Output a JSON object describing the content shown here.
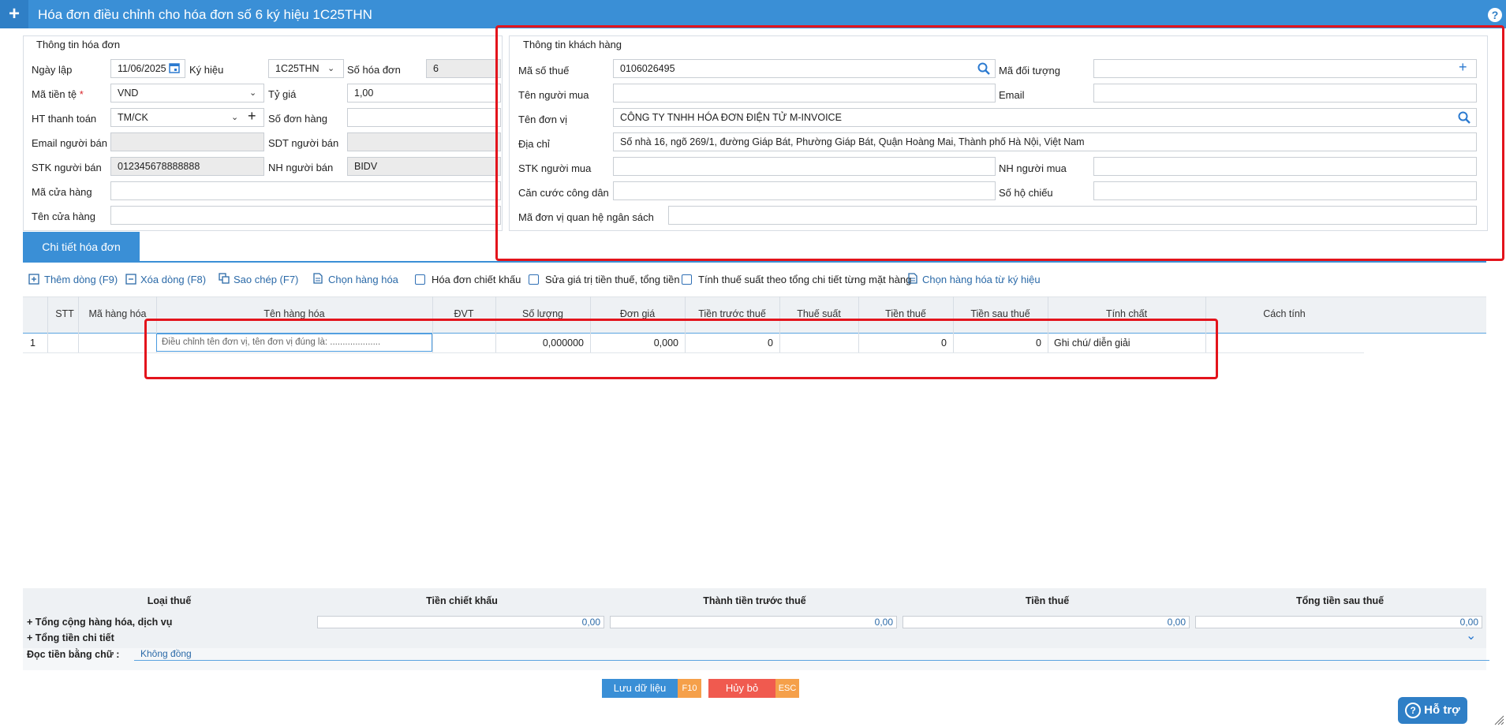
{
  "window": {
    "title": "Hóa đơn điều chỉnh cho hóa đơn số 6 ký hiệu 1C25THN",
    "help_glyph": "?"
  },
  "invoice_info": {
    "section_title": "Thông tin hóa đơn",
    "ngay_lap_label": "Ngày lập",
    "ngay_lap_value": "11/06/2025",
    "ky_hieu_label": "Ký hiệu",
    "ky_hieu_value": "1C25THN",
    "so_hoa_don_label": "Số hóa đơn",
    "so_hoa_don_value": "6",
    "ma_tien_te_label": "Mã tiền tệ",
    "required_mark": "*",
    "ma_tien_te_value": "VND",
    "ty_gia_label": "Tỷ giá",
    "ty_gia_value": "1,00",
    "ht_thanh_toan_label": "HT thanh toán",
    "ht_thanh_toan_value": "TM/CK",
    "so_don_hang_label": "Số đơn hàng",
    "so_don_hang_value": "",
    "email_nguoi_ban_label": "Email người bán",
    "email_nguoi_ban_value": "",
    "sdt_nguoi_ban_label": "SDT người bán",
    "sdt_nguoi_ban_value": "",
    "stk_nguoi_ban_label": "STK người bán",
    "stk_nguoi_ban_value": "012345678888888",
    "nh_nguoi_ban_label": "NH người bán",
    "nh_nguoi_ban_value": "BIDV",
    "ma_cua_hang_label": "Mã cửa hàng",
    "ma_cua_hang_value": "",
    "ten_cua_hang_label": "Tên cửa hàng",
    "ten_cua_hang_value": ""
  },
  "customer_info": {
    "section_title": "Thông tin khách hàng",
    "ma_so_thue_label": "Mã số thuế",
    "ma_so_thue_value": "0106026495",
    "ma_doi_tuong_label": "Mã đối tượng",
    "ma_doi_tuong_value": "",
    "ten_nguoi_mua_label": "Tên người mua",
    "ten_nguoi_mua_value": "",
    "email_label": "Email",
    "email_value": "",
    "ten_don_vi_label": "Tên đơn vị",
    "ten_don_vi_value": "CÔNG TY TNHH HÓA ĐƠN ĐIỆN TỬ M-INVOICE",
    "dia_chi_label": "Địa chỉ",
    "dia_chi_value": "Số nhà 16, ngõ 269/1, đường Giáp Bát, Phường Giáp Bát, Quận Hoàng Mai, Thành phố Hà Nội, Việt Nam",
    "stk_nguoi_mua_label": "STK người mua",
    "stk_nguoi_mua_value": "",
    "nh_nguoi_mua_label": "NH người mua",
    "nh_nguoi_mua_value": "",
    "cccd_label": "Căn cước công dân",
    "cccd_value": "",
    "so_ho_chieu_label": "Số hộ chiếu",
    "so_ho_chieu_value": "",
    "ma_dvqhns_label": "Mã đơn vị quan hệ ngân sách",
    "ma_dvqhns_value": ""
  },
  "details": {
    "tab_label": "Chi tiết hóa đơn",
    "toolbar": {
      "add_row": "Thêm dòng (F9)",
      "delete_row": "Xóa dòng (F8)",
      "copy": "Sao chép (F7)",
      "choose_goods": "Chọn hàng hóa",
      "discount_invoice": "Hóa đơn chiết khấu",
      "edit_tax_total": "Sửa giá trị tiền thuế, tổng tiền",
      "calc_tax_rate": "Tính thuế suất theo tổng chi tiết từng mặt hàng",
      "choose_goods_from_symbol": "Chọn hàng hóa từ ký hiệu"
    },
    "columns": [
      "STT",
      "Mã hàng hóa",
      "Tên hàng hóa",
      "ĐVT",
      "Số lượng",
      "Đơn giá",
      "Tiền trước thuế",
      "Thuế suất",
      "Tiền thuế",
      "Tiền sau thuế",
      "Tính chất",
      "Cách tính"
    ],
    "rows": [
      {
        "index": "1",
        "stt": "",
        "ma_hang_hoa": "",
        "ten_hang_hoa": "Điều chỉnh tên đơn vị, tên đơn vị đúng là: ....................",
        "dvt": "",
        "so_luong": "0,000000",
        "don_gia": "0,000",
        "tien_truoc_thue": "0",
        "thue_suat": "",
        "tien_thue": "0",
        "tien_sau_thue": "0",
        "tinh_chat": "Ghi chú/ diễn giải",
        "cach_tinh": ""
      }
    ]
  },
  "summary": {
    "headers": [
      "Loại thuế",
      "Tiền chiết khấu",
      "Thành tiền trước thuế",
      "Tiền thuế",
      "Tổng tiền sau thuế"
    ],
    "total_goods_label": "+ Tổng cộng hàng hóa, dịch vụ",
    "total_values": [
      "0,00",
      "0,00",
      "0,00",
      "0,00"
    ],
    "total_detail_label": "+ Tổng tiền chi tiết",
    "amount_words_label": "Đọc tiền bằng chữ :",
    "amount_words_value": "Không đồng"
  },
  "actions": {
    "save_label": "Lưu dữ liệu",
    "save_key": "F10",
    "cancel_label": "Hủy bỏ",
    "cancel_key": "ESC",
    "help_label": "Hỗ trợ"
  },
  "colors": {
    "primary": "#3a8fd6",
    "highlight_box": "#e3141c",
    "save_button": "#3a8fd6",
    "cancel_button": "#f05a4f",
    "key_badge": "#f5a04a"
  }
}
